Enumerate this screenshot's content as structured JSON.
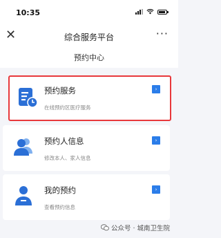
{
  "status_bar": {
    "time": "10:35"
  },
  "nav": {
    "close": "✕",
    "title": "综合服务平台",
    "more": "···"
  },
  "section": {
    "title": "预约中心"
  },
  "cards": [
    {
      "title": "预约服务",
      "subtitle": "在线预约区医疗服务",
      "icon": "calendar-clock-icon",
      "selected": true
    },
    {
      "title": "预约人信息",
      "subtitle": "修改本人、家人信息",
      "icon": "users-icon",
      "selected": false
    },
    {
      "title": "我的预约",
      "subtitle": "查看预约信息",
      "icon": "user-card-icon",
      "selected": false
    }
  ],
  "colors": {
    "accent": "#2b7de9",
    "highlight": "#e8383b"
  },
  "footer": {
    "text": "公众号 · 城南卫生院"
  }
}
